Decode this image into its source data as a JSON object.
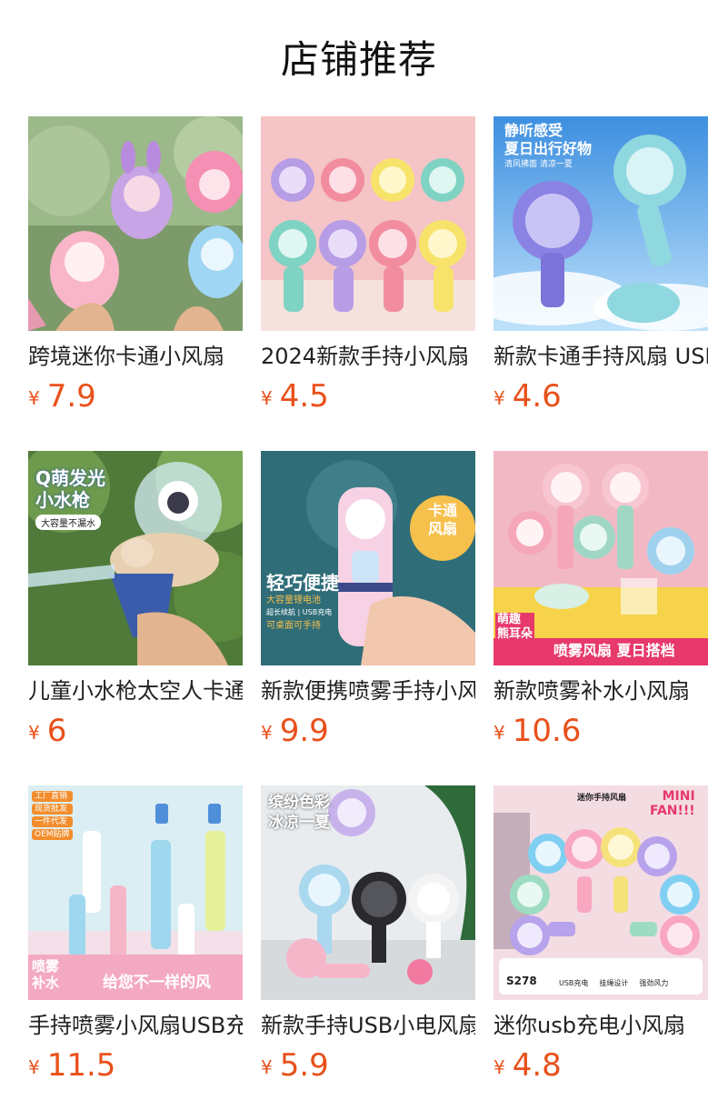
{
  "section_title": "店铺推荐",
  "currency_symbol": "¥",
  "accent_color": "#e9501a",
  "products": [
    {
      "name": "跨境迷你卡通小风扇",
      "price": "7.9",
      "image": "cartoon-bunny-fans-held-in-hands"
    },
    {
      "name": "2024新款手持小风扇",
      "price": "4.5",
      "image": "eight-colorful-handheld-fans"
    },
    {
      "name": "新款卡通手持风扇 USB",
      "price": "4.6",
      "image": "purple-and-teal-handheld-fans-sky",
      "overlay": {
        "line1": "静听感受",
        "line2": "夏日出行好物",
        "line3": "清风拂面 清凉一夏"
      }
    },
    {
      "name": "儿童小水枪太空人卡通",
      "price": "6",
      "image": "astronaut-water-gun",
      "overlay": {
        "line1": "Q萌发光",
        "line2": "小水枪",
        "line3": "大容量不漏水"
      }
    },
    {
      "name": "新款便携喷雾手持小风扇",
      "price": "9.9",
      "image": "pink-spray-fan-in-hand",
      "overlay": {
        "line1": "轻巧便捷",
        "line2": "大容量锂电池",
        "line3": "超长续航 | USB充电",
        "line4": "可桌面可手持",
        "line5": "卡通",
        "line6": "风扇"
      }
    },
    {
      "name": "新款喷雾补水小风扇",
      "price": "10.6",
      "image": "bear-ear-spray-fans",
      "overlay": {
        "line1": "萌趣",
        "line2": "熊耳朵",
        "line3": "喷雾风扇 夏日搭档"
      }
    },
    {
      "name": "手持喷雾小风扇USB充电",
      "price": "11.5",
      "image": "spray-bottle-fans-pastel",
      "overlay": {
        "line1": "喷雾",
        "line2": "补水",
        "line3": "给您不一样的风",
        "tags": [
          "工厂直销",
          "现货批发",
          "一件代发",
          "OEM贴牌"
        ]
      }
    },
    {
      "name": "新款手持USB小电风扇",
      "price": "5.9",
      "image": "handheld-fans-with-stands",
      "overlay": {
        "line1": "缤纷色彩",
        "line2": "冰凉一夏"
      }
    },
    {
      "name": "迷你usb充电小风扇",
      "price": "4.8",
      "image": "mini-handheld-fan-collection",
      "overlay": {
        "line1": "迷你手持风扇",
        "line2": "MINI",
        "line3": "FAN!!!",
        "line4": "S278",
        "features": [
          "USB充电",
          "挂绳设计",
          "强劲风力"
        ]
      }
    }
  ]
}
